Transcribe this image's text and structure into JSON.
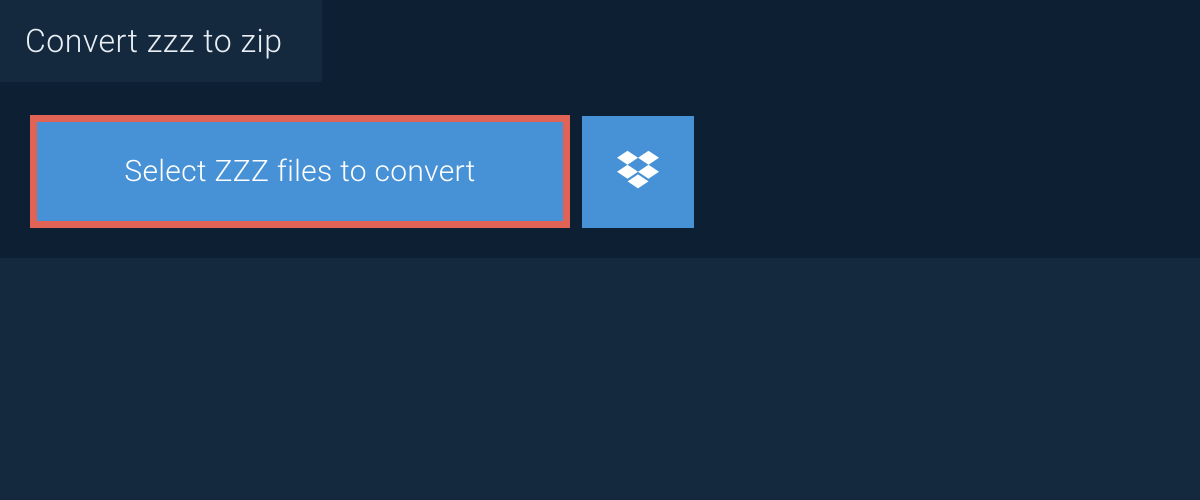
{
  "tab": {
    "title": "Convert zzz to zip"
  },
  "actions": {
    "select_files_label": "Select ZZZ files to convert"
  },
  "colors": {
    "background": "#14283e",
    "panel": "#0d2033",
    "button": "#4791d6",
    "button_highlight_border": "#e16355",
    "text": "#ffffff"
  }
}
